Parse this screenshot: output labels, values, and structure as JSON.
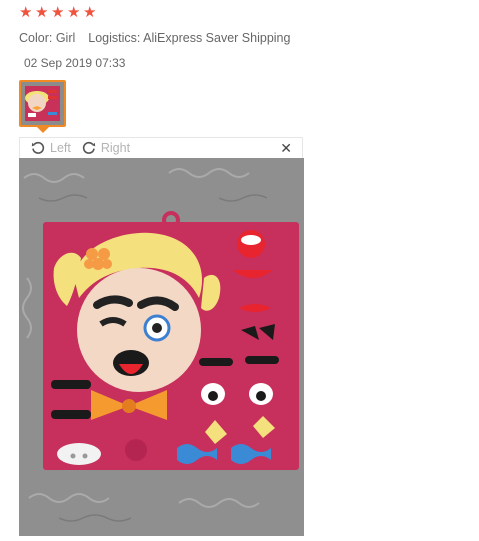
{
  "review": {
    "rating": 5,
    "color_label": "Color: Girl",
    "logistics_label": "Logistics: AliExpress Saver Shipping",
    "date": "02 Sep 2019 07:33"
  },
  "viewer": {
    "rotate_left_label": "Left",
    "rotate_right_label": "Right",
    "close_symbol": "✕"
  },
  "colors": {
    "star": "#f0533f",
    "thumb_border": "#f08a24",
    "toolbar_text": "#b3b3b3"
  },
  "icons": {
    "rotate_left": "rotate-left-icon",
    "rotate_right": "rotate-right-icon",
    "close": "close-icon",
    "star": "star-icon"
  }
}
